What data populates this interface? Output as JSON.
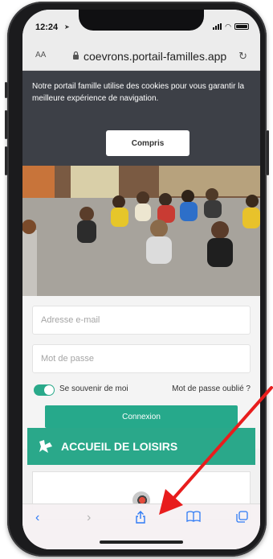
{
  "status_bar": {
    "time": "12:24"
  },
  "url_bar": {
    "text_size": "AA",
    "domain": "coevrons.portail-familles.app"
  },
  "cookie_banner": {
    "message": "Notre portail famille utilise des cookies pour vous garantir la meilleure expérience de navigation.",
    "accept_label": "Compris"
  },
  "login_form": {
    "email_placeholder": "Adresse e-mail",
    "password_placeholder": "Mot de passe",
    "remember_label": "Se souvenir de moi",
    "remember_on": true,
    "forgot_label": "Mot de passe oublié ?",
    "submit_label": "Connexion"
  },
  "leisure_banner": {
    "label": "ACCUEIL DE LOISIRS"
  },
  "icons": {
    "back": "chevron-left-icon",
    "forward": "chevron-right-icon",
    "share": "share-icon",
    "bookmarks": "book-icon",
    "tabs": "tabs-icon",
    "lock": "lock-icon",
    "reload": "reload-icon"
  },
  "colors": {
    "accent": "#26a98b",
    "banner_bg": "#3d4047",
    "ios_blue": "#2f7bf5",
    "arrow": "#e81d1d"
  }
}
